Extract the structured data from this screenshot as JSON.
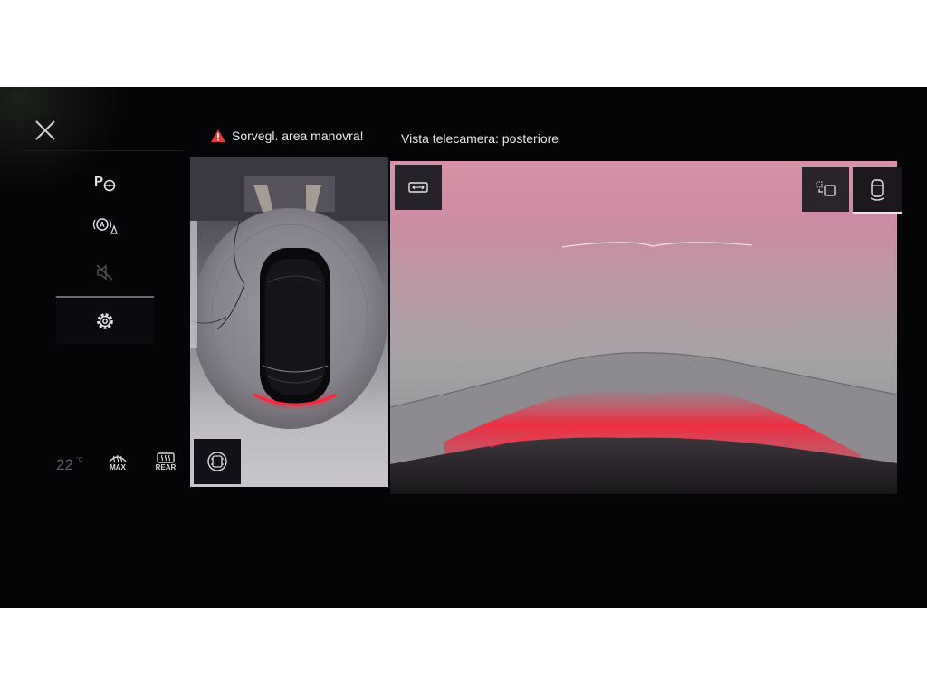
{
  "header": {
    "warning_text": "Sorvegl. area manovra!",
    "camera_view_text": "Vista telecamera: posteriore"
  },
  "menu": {
    "items": [
      {
        "name": "park-steer-assist",
        "label": "P"
      },
      {
        "name": "auto-hold-warning",
        "label": ""
      },
      {
        "name": "sound-muted",
        "label": ""
      },
      {
        "name": "settings",
        "label": ""
      }
    ]
  },
  "climate": {
    "temperature": "22",
    "unit": "°C",
    "max_defrost_label": "MAX",
    "rear_defrost_label": "REAR"
  },
  "icons": {
    "close": "close-icon",
    "warning": "warning-triangle-icon",
    "park_assist": "parking-steering-icon",
    "auto_hold": "auto-hold-icon",
    "mute": "speaker-muted-icon",
    "settings": "gear-icon",
    "view_mode": "camera-view-icon",
    "width_mode": "vehicle-width-icon",
    "switch_view": "switch-camera-icon",
    "rear_camera": "rear-camera-icon"
  },
  "colors": {
    "background": "#050407",
    "warning_red": "#e23b3b",
    "guide_line_red": "#ff1f36",
    "text": "#e8e6ec"
  }
}
